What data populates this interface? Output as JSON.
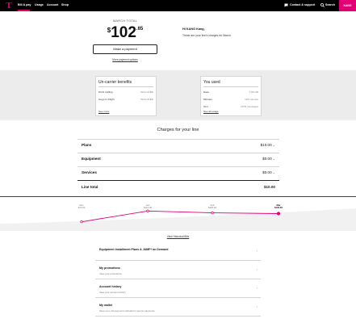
{
  "nav": {
    "items": [
      "Bill & pay",
      "Usage",
      "Account",
      "Shop"
    ],
    "contact": "Contact & support",
    "search": "Search",
    "account_label": "KANG"
  },
  "colors": {
    "brand": "#e20074",
    "nav_bg": "#000000",
    "band_bg": "#ececec"
  },
  "icons": {
    "logo": "t-mobile-logo-icon",
    "chat": "chat-icon",
    "search": "search-icon"
  },
  "summary": {
    "label": "MARCH TOTAL",
    "currency": "$",
    "dollars": "102",
    "cents": ".65",
    "pay_button": "Make a payment",
    "pay_options": "More payment options",
    "greeting": "Hi KANG Kang,",
    "message": "These are your line's charges for March."
  },
  "benefits": {
    "title": "Un-carrier benefits",
    "rows": [
      {
        "label": "Wi-Fi Calling",
        "value": "INCLUDED"
      },
      {
        "label": "Gogo In-Flight",
        "value": "INCLUDED"
      }
    ],
    "link": "See more"
  },
  "usage": {
    "title": "You used",
    "rows": [
      {
        "label": "Data",
        "value": "1.86 GB"
      },
      {
        "label": "Minutes",
        "value": "126 minutes"
      },
      {
        "label": "Text",
        "value": "2079 messages"
      }
    ],
    "link": "See all usage"
  },
  "charges": {
    "title": "Charges for your line",
    "rows": [
      {
        "label": "Plans",
        "value": "$10.00"
      },
      {
        "label": "Equipment",
        "value": "$0.00"
      },
      {
        "label": "Services",
        "value": "$0.00"
      }
    ],
    "total_label": "Line total",
    "total_value": "$10.00"
  },
  "chart_data": {
    "type": "line",
    "categories": [
      "Dec",
      "Jan",
      "Feb",
      "Mar"
    ],
    "point_labels": [
      "$70.00",
      "$113.00",
      "$105.63",
      "$102.65"
    ],
    "values": [
      70.0,
      113.0,
      105.63,
      102.65
    ],
    "selected_index": 3,
    "ylim": [
      40,
      130
    ],
    "color": "#e20074"
  },
  "history_link": "View Historical Bills",
  "list": [
    {
      "title": "Equipment Installment Plans & JUMP! on Demand",
      "subtitle": ""
    },
    {
      "title": "My promotions",
      "subtitle": "View your promotions"
    },
    {
      "title": "Account history",
      "subtitle": "View your account history"
    },
    {
      "title": "My wallet",
      "subtitle": "Save up to 10 payment methods for secure payments"
    }
  ]
}
